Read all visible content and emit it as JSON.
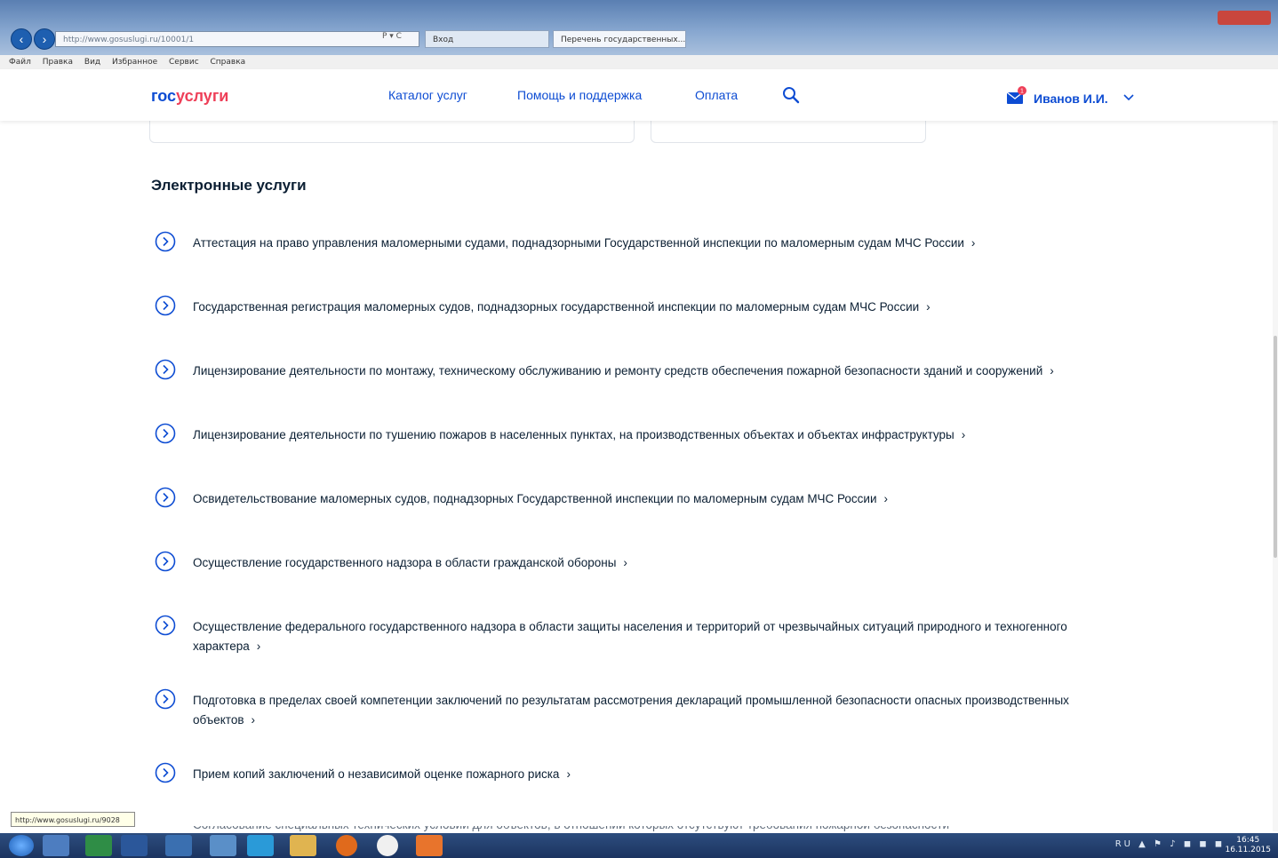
{
  "browser": {
    "address": "http://www.gosuslugi.ru/10001/1",
    "address_actions": "P ▾ C",
    "tabs": [
      "Вход",
      "Перечень государственных..."
    ],
    "menu": [
      "Файл",
      "Правка",
      "Вид",
      "Избранное",
      "Сервис",
      "Справка"
    ]
  },
  "header": {
    "logo_part1": "гос",
    "logo_part2": "услуги",
    "nav": [
      "Каталог услуг",
      "Помощь и поддержка",
      "Оплата"
    ],
    "user": "Иванов И.И.",
    "notification_count": "1"
  },
  "content": {
    "section_title": "Электронные услуги",
    "services": [
      "Аттестация на право управления маломерными судами, поднадзорными Государственной инспекции по маломерным судам МЧС России",
      "Государственная регистрация маломерных судов, поднадзорных государственной инспекции по маломерным судам МЧС России",
      "Лицензирование деятельности по монтажу, техническому обслуживанию и ремонту средств обеспечения пожарной безопасности зданий и сооружений",
      "Лицензирование деятельности по тушению пожаров в населенных пунктах, на производственных объектах и объектах инфраструктуры",
      "Освидетельствование маломерных судов, поднадзорных Государственной инспекции по маломерным судам МЧС России",
      "Осуществление государственного надзора в области гражданской обороны",
      "Осуществление федерального государственного надзора в области защиты населения и территорий от чрезвычайных ситуаций природного и техногенного характера",
      "Подготовка в пределах своей компетенции заключений по результатам рассмотрения деклараций промышленной безопасности опасных производственных объектов",
      "Прием копий заключений о независимой оценке пожарного риска"
    ],
    "arrow": "›",
    "cut_service": "Согласование специальных технических условий для объектов, в отношении которых отсутствуют требования пожарной безопасности"
  },
  "status_bar": {
    "url": "http://www.gosuslugi.ru/9028"
  },
  "taskbar": {
    "tray": "RU ▲ ⚑ ♪ ◼ ◼ ◼",
    "time": "16:45",
    "date": "16.11.2015"
  },
  "colors": {
    "brand_blue": "#0d4cd3",
    "brand_red": "#ee3f58",
    "text": "#0b1f33"
  }
}
